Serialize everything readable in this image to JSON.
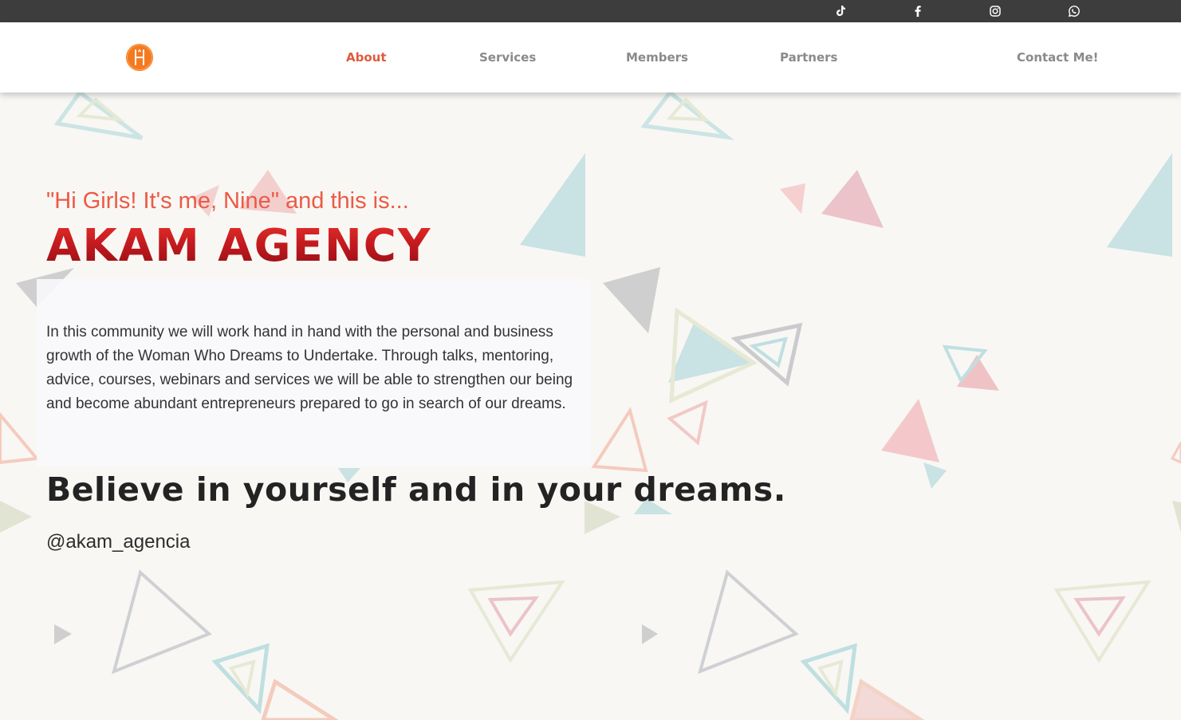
{
  "topbar": {
    "social": [
      {
        "name": "tiktok-icon"
      },
      {
        "name": "facebook-icon"
      },
      {
        "name": "instagram-icon"
      },
      {
        "name": "whatsapp-icon"
      }
    ]
  },
  "navbar": {
    "logo": "logo-icon",
    "items": [
      {
        "label": "About",
        "active": true
      },
      {
        "label": "Services",
        "active": false
      },
      {
        "label": "Members",
        "active": false
      },
      {
        "label": "Partners",
        "active": false
      },
      {
        "label": "Contact Me!",
        "active": false
      }
    ],
    "active_color": "#e05a3c",
    "inactive_color": "#8a8a8a"
  },
  "hero": {
    "greeting": "\"Hi Girls! It's me, Nine\" and this is...",
    "brand": "AKAM AGENCY",
    "description": "In this community we will work hand in hand with the personal and business growth of the Woman Who Dreams to Undertake. Through talks, mentoring, advice, courses, webinars and services we will be able to strengthen our being and become abundant entrepreneurs prepared to go in search of our dreams.",
    "tagline": "Believe in yourself and in your dreams.",
    "handle": "@akam_agencia"
  },
  "colors": {
    "topbar": "#3d3d3d",
    "accent": "#ec5a45",
    "brand_red": "#c31a1f",
    "background": "#f8f7f4"
  }
}
